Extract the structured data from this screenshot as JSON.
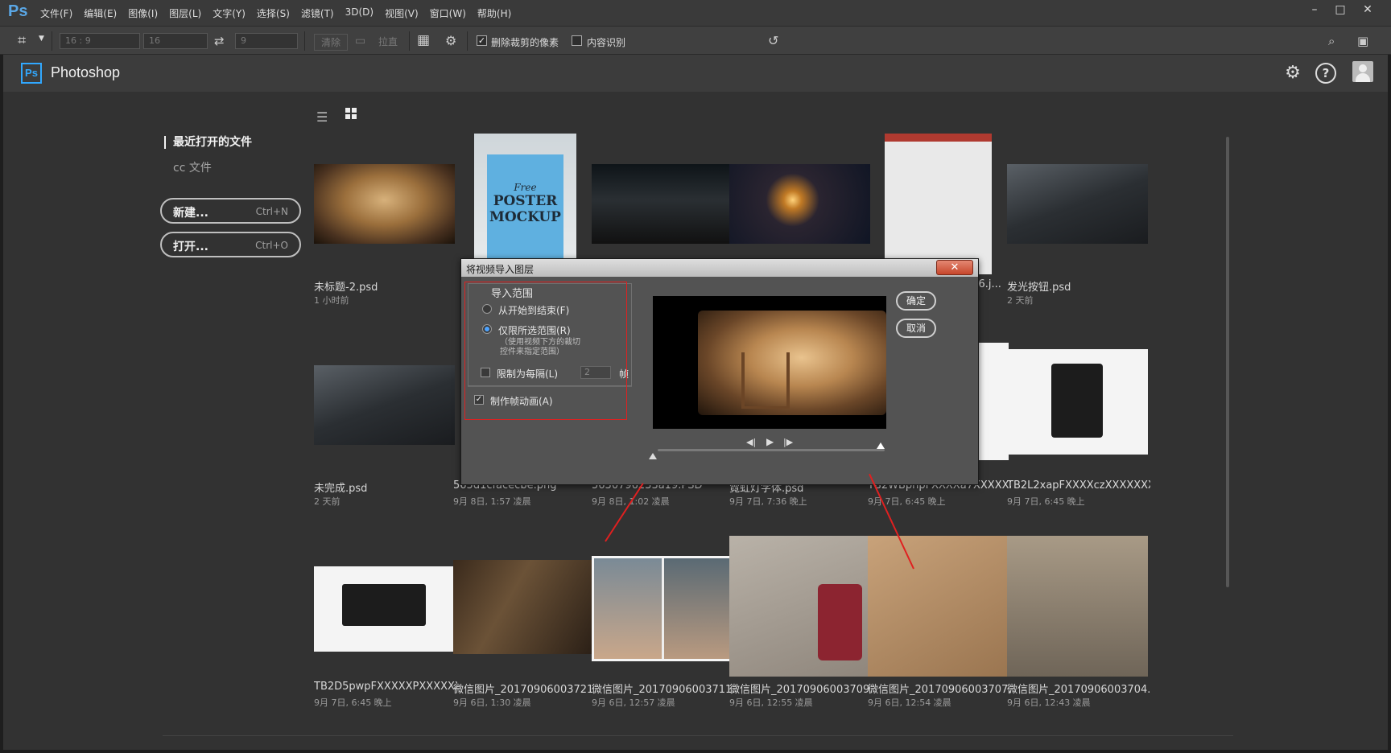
{
  "menubar": {
    "logo": "Ps",
    "items": [
      "文件(F)",
      "编辑(E)",
      "图像(I)",
      "图层(L)",
      "文字(Y)",
      "选择(S)",
      "滤镜(T)",
      "3D(D)",
      "视图(V)",
      "窗口(W)",
      "帮助(H)"
    ],
    "window_controls": [
      "–",
      "□",
      "✕"
    ]
  },
  "options": {
    "ratio": "16 : 9",
    "width": "16",
    "height": "9",
    "clear_label": "清除",
    "straighten_label": "拉直",
    "delete_cropped_label": "删除裁剪的像素",
    "delete_cropped_checked": true,
    "content_aware_label": "内容识别",
    "content_aware_checked": false
  },
  "header": {
    "badge": "Ps",
    "app_name": "Photoshop"
  },
  "sidebar": {
    "recent_label": "最近打开的文件",
    "cc_label": "cc 文件",
    "new_label": "新建...",
    "new_shortcut": "Ctrl+N",
    "open_label": "打开...",
    "open_shortcut": "Ctrl+O"
  },
  "files": [
    {
      "name": "未标题-2.psd",
      "time": "1 小时前"
    },
    {
      "name": "",
      "time": ""
    },
    {
      "name": "",
      "time": ""
    },
    {
      "name": "",
      "time": ""
    },
    {
      "name": "20170909152656.j...",
      "time": ""
    },
    {
      "name": "发光按钮.psd",
      "time": "2 天前"
    },
    {
      "name": "未完成.psd",
      "time": "2 天前"
    },
    {
      "name": "565d1cfacecbe.png",
      "time": "9月 8日, 1:57 凌晨"
    },
    {
      "name": "5630796233a19.PSD",
      "time": "9月 8日, 1:02 凌晨"
    },
    {
      "name": "霓虹灯字体.psd",
      "time": "9月 7日, 7:36 晚上"
    },
    {
      "name": "TB2WBpnpFXXXXa7XXXXXXX...",
      "time": "9月 7日, 6:45 晚上"
    },
    {
      "name": "TB2L2xapFXXXXczXXXXXXXX...",
      "time": "9月 7日, 6:45 晚上"
    },
    {
      "name": "TB2D5pwpFXXXXXPXXXXXX...",
      "time": "9月 7日, 6:45 晚上"
    },
    {
      "name": "微信图片_20170906003721.j...",
      "time": "9月 6日, 1:30 凌晨"
    },
    {
      "name": "微信图片_20170906003711.jpg",
      "time": "9月 6日, 12:57 凌晨"
    },
    {
      "name": "微信图片_20170906003709...",
      "time": "9月 6日, 12:55 凌晨"
    },
    {
      "name": "微信图片_20170906003707...",
      "time": "9月 6日, 12:54 凌晨"
    },
    {
      "name": "微信图片_20170906003704...",
      "time": "9月 6日, 12:43 凌晨"
    }
  ],
  "poster": {
    "line1": "Free",
    "line2": "POSTER",
    "line3": "MOCKUP"
  },
  "dialog": {
    "title": "将视频导入图层",
    "close": "✕",
    "group_title": "导入范围",
    "opt_all": "从开始到结束(F)",
    "opt_selected": "仅限所选范围(R)",
    "note1": "（使用视频下方的裁切",
    "note2": "控件来指定范围）",
    "limit_label": "限制为每隔(L)",
    "limit_value": "2",
    "frames_unit": "帧",
    "make_anim_label": "制作帧动画(A)",
    "ok": "确定",
    "cancel": "取消",
    "selected_option": "opt_selected",
    "limit_checked": false,
    "make_anim_checked": true
  },
  "colors": {
    "accent": "#31a8ff",
    "annotation": "#e02020"
  }
}
